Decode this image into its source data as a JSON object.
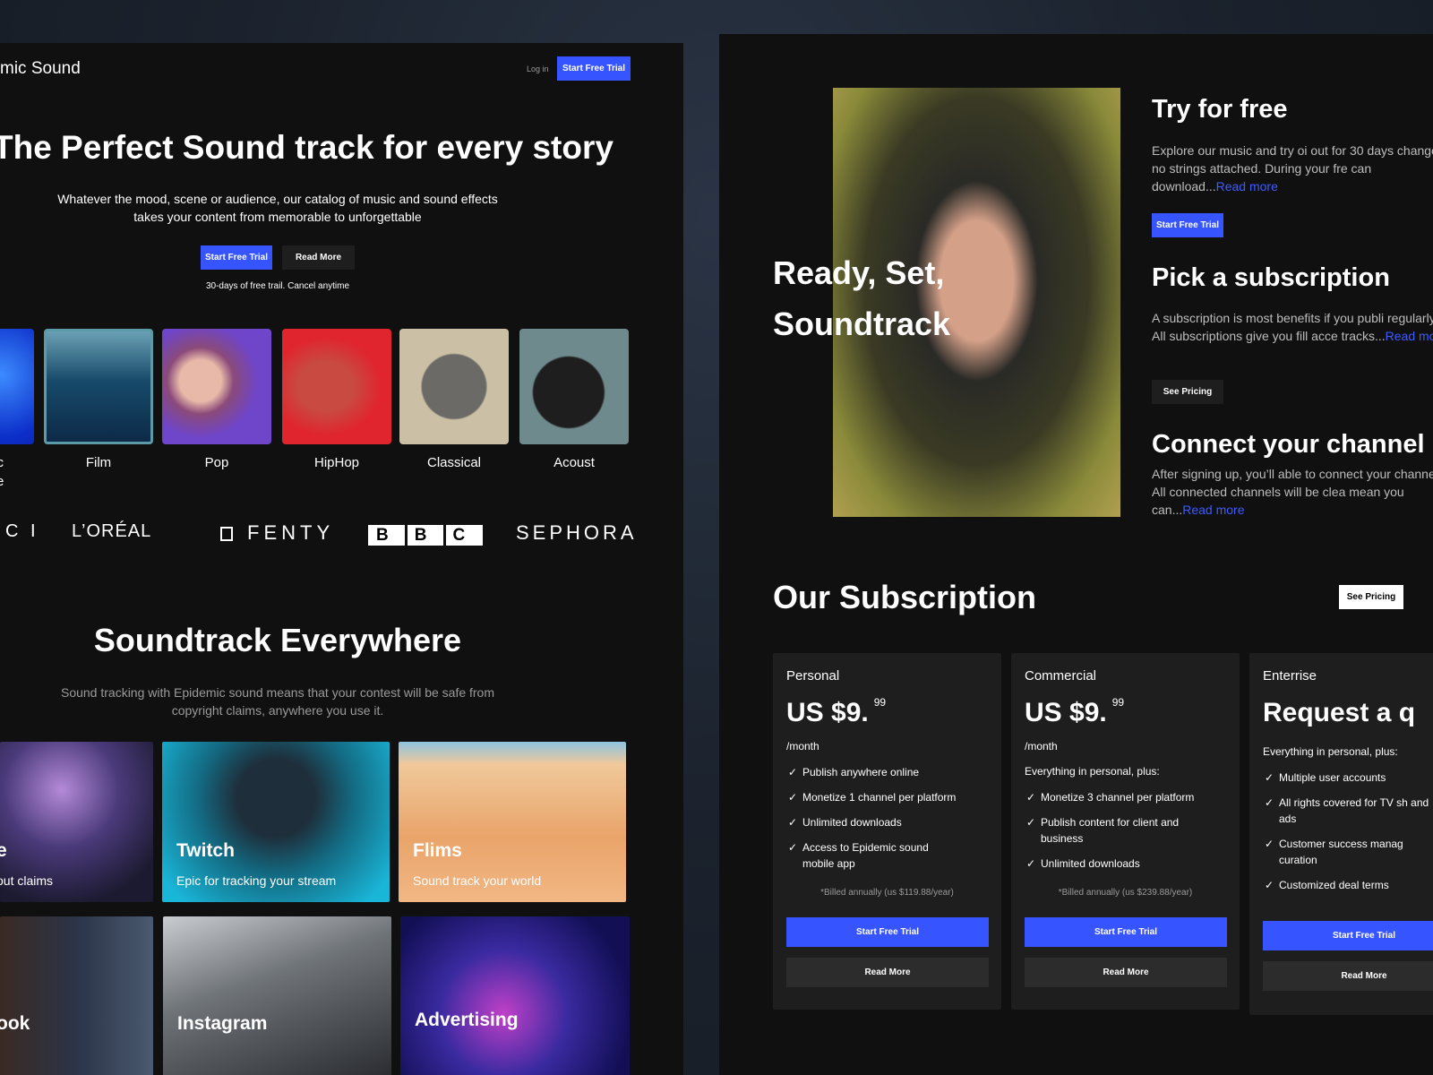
{
  "colors": {
    "accent": "#3654ff",
    "link": "#3d5cff",
    "background": "#101010",
    "card": "#1e1e1e"
  },
  "left": {
    "brand": "mic Sound",
    "nav": {
      "login": "Log in",
      "trial": "Start Free Trial"
    },
    "hero": {
      "title": "The Perfect Sound track for every story",
      "subtitle_1": "Whatever the mood, scene or audience, our catalog of music and sound effects",
      "subtitle_2": "takes your content from memorable to unforgettable",
      "primary": "Start Free Trial",
      "secondary": "Read More",
      "note": "30-days of free trail. Cancel anytime"
    },
    "genres": [
      {
        "label": "ic"
      },
      {
        "label": "Film"
      },
      {
        "label": "Pop"
      },
      {
        "label": "HipHop"
      },
      {
        "label": "Classical"
      },
      {
        "label": "Acoust"
      }
    ],
    "genre_partial_line2": "e",
    "logos": [
      "C I",
      "L’ORÉAL",
      "FENTY",
      "BBC",
      "SEPHORA"
    ],
    "everywhere": {
      "title": "Soundtrack Everywhere",
      "subtitle_1": "Sound tracking with Epidemic sound means that your contest will be safe from",
      "subtitle_2": "copyright claims, anywhere you use it."
    },
    "uses": [
      {
        "title": "e",
        "desc": "out claims"
      },
      {
        "title": "Twitch",
        "desc": "Epic for tracking your stream"
      },
      {
        "title": "Flims",
        "desc": "Sound track your world"
      },
      {
        "title": "ook",
        "desc": ""
      },
      {
        "title": "Instagram",
        "desc": ""
      },
      {
        "title": "Advertising",
        "desc": ""
      }
    ]
  },
  "right": {
    "hero_line1": "Ready, Set,",
    "hero_line2": "Soundtrack",
    "steps": [
      {
        "title": "Try for free",
        "text": "Explore our music and try oi out for 30 days change, no strings attached. During your fre can download...",
        "link": "Read more",
        "button": "Start Free Trial"
      },
      {
        "title": "Pick a subscription",
        "text": "A  subscription is most benefits if you publi regularly. All subscriptions give you fill acce tracks...",
        "link": "Read more",
        "button": "See Pricing"
      },
      {
        "title": "Connect your channel",
        "text": "After signing up, you’ll able to connect your channel. All connected channels will be clea mean you can...",
        "link": "Read more"
      }
    ],
    "subscription": {
      "title": "Our Subscription",
      "button": "See Pricing"
    },
    "plans": [
      {
        "name": "Personal",
        "price": "US $9.",
        "cents": "99",
        "period": "/month",
        "features": [
          "Publish anywhere online",
          "Monetize 1 channel per platform",
          "Unlimited downloads",
          "Access to Epidemic sound mobile app"
        ],
        "billing": "*Billed annually (us $119.88/year)",
        "primary": "Start Free Trial",
        "secondary": "Read More"
      },
      {
        "name": "Commercial",
        "price": "US $9.",
        "cents": "99",
        "period": "/month",
        "intro": "Everything in personal, plus:",
        "features": [
          "Monetize 3 channel per platform",
          "Publish content for client and business",
          "Unlimited downloads"
        ],
        "billing": "*Billed annually (us $239.88/year)",
        "primary": "Start Free Trial",
        "secondary": "Read More"
      },
      {
        "name": "Enterrise",
        "price": "Request a q",
        "intro": "Everything in personal, plus:",
        "features": [
          "Multiple user accounts",
          "All rights covered for TV sh and ads",
          "Customer success manag curation",
          "Customized deal terms"
        ],
        "primary": "Start Free Trial",
        "secondary": "Read More"
      }
    ]
  }
}
